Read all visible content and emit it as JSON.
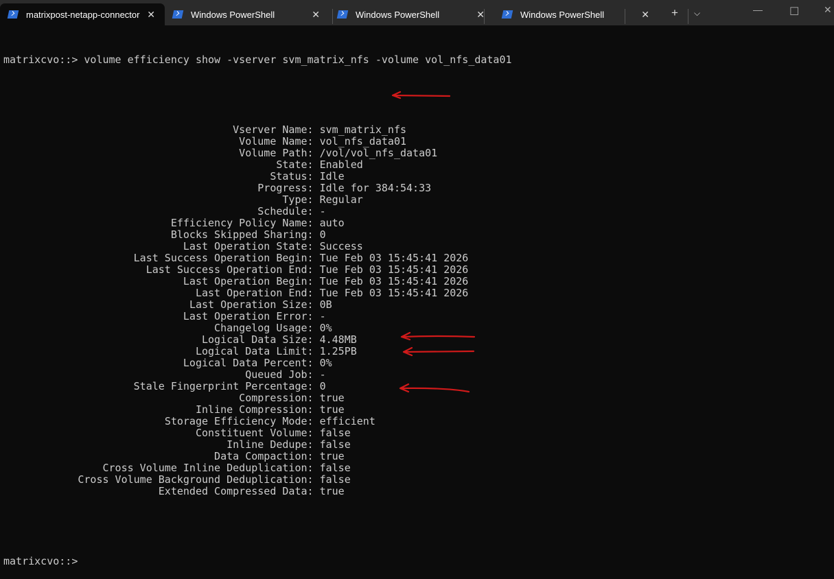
{
  "tabs": [
    {
      "label": "matrixpost-netapp-connector",
      "active": true
    },
    {
      "label": "Windows PowerShell"
    },
    {
      "label": "Windows PowerShell"
    },
    {
      "label": "Windows PowerShell"
    }
  ],
  "terminal": {
    "prompt": "matrixcvo::>",
    "command": "volume efficiency show -vserver svm_matrix_nfs -volume vol_nfs_data01",
    "fields": [
      [
        "Vserver Name",
        "svm_matrix_nfs"
      ],
      [
        "Volume Name",
        "vol_nfs_data01"
      ],
      [
        "Volume Path",
        "/vol/vol_nfs_data01"
      ],
      [
        "State",
        "Enabled"
      ],
      [
        "Status",
        "Idle"
      ],
      [
        "Progress",
        "Idle for 384:54:33"
      ],
      [
        "Type",
        "Regular"
      ],
      [
        "Schedule",
        "-"
      ],
      [
        "Efficiency Policy Name",
        "auto"
      ],
      [
        "Blocks Skipped Sharing",
        "0"
      ],
      [
        "Last Operation State",
        "Success"
      ],
      [
        "Last Success Operation Begin",
        "Tue Feb 03 15:45:41 2026"
      ],
      [
        "Last Success Operation End",
        "Tue Feb 03 15:45:41 2026"
      ],
      [
        "Last Operation Begin",
        "Tue Feb 03 15:45:41 2026"
      ],
      [
        "Last Operation End",
        "Tue Feb 03 15:45:41 2026"
      ],
      [
        "Last Operation Size",
        "0B"
      ],
      [
        "Last Operation Error",
        "-"
      ],
      [
        "Changelog Usage",
        "0%"
      ],
      [
        "Logical Data Size",
        "4.48MB"
      ],
      [
        "Logical Data Limit",
        "1.25PB"
      ],
      [
        "Logical Data Percent",
        "0%"
      ],
      [
        "Queued Job",
        "-"
      ],
      [
        "Stale Fingerprint Percentage",
        "0"
      ],
      [
        "Compression",
        "true"
      ],
      [
        "Inline Compression",
        "true"
      ],
      [
        "Storage Efficiency Mode",
        "efficient"
      ],
      [
        "Constituent Volume",
        "false"
      ],
      [
        "Inline Dedupe",
        "false"
      ],
      [
        "Data Compaction",
        "true"
      ],
      [
        "Cross Volume Inline Deduplication",
        "false"
      ],
      [
        "Cross Volume Background Deduplication",
        "false"
      ],
      [
        "Extended Compressed Data",
        "true"
      ]
    ]
  },
  "annotation_color": "#d11a1a"
}
